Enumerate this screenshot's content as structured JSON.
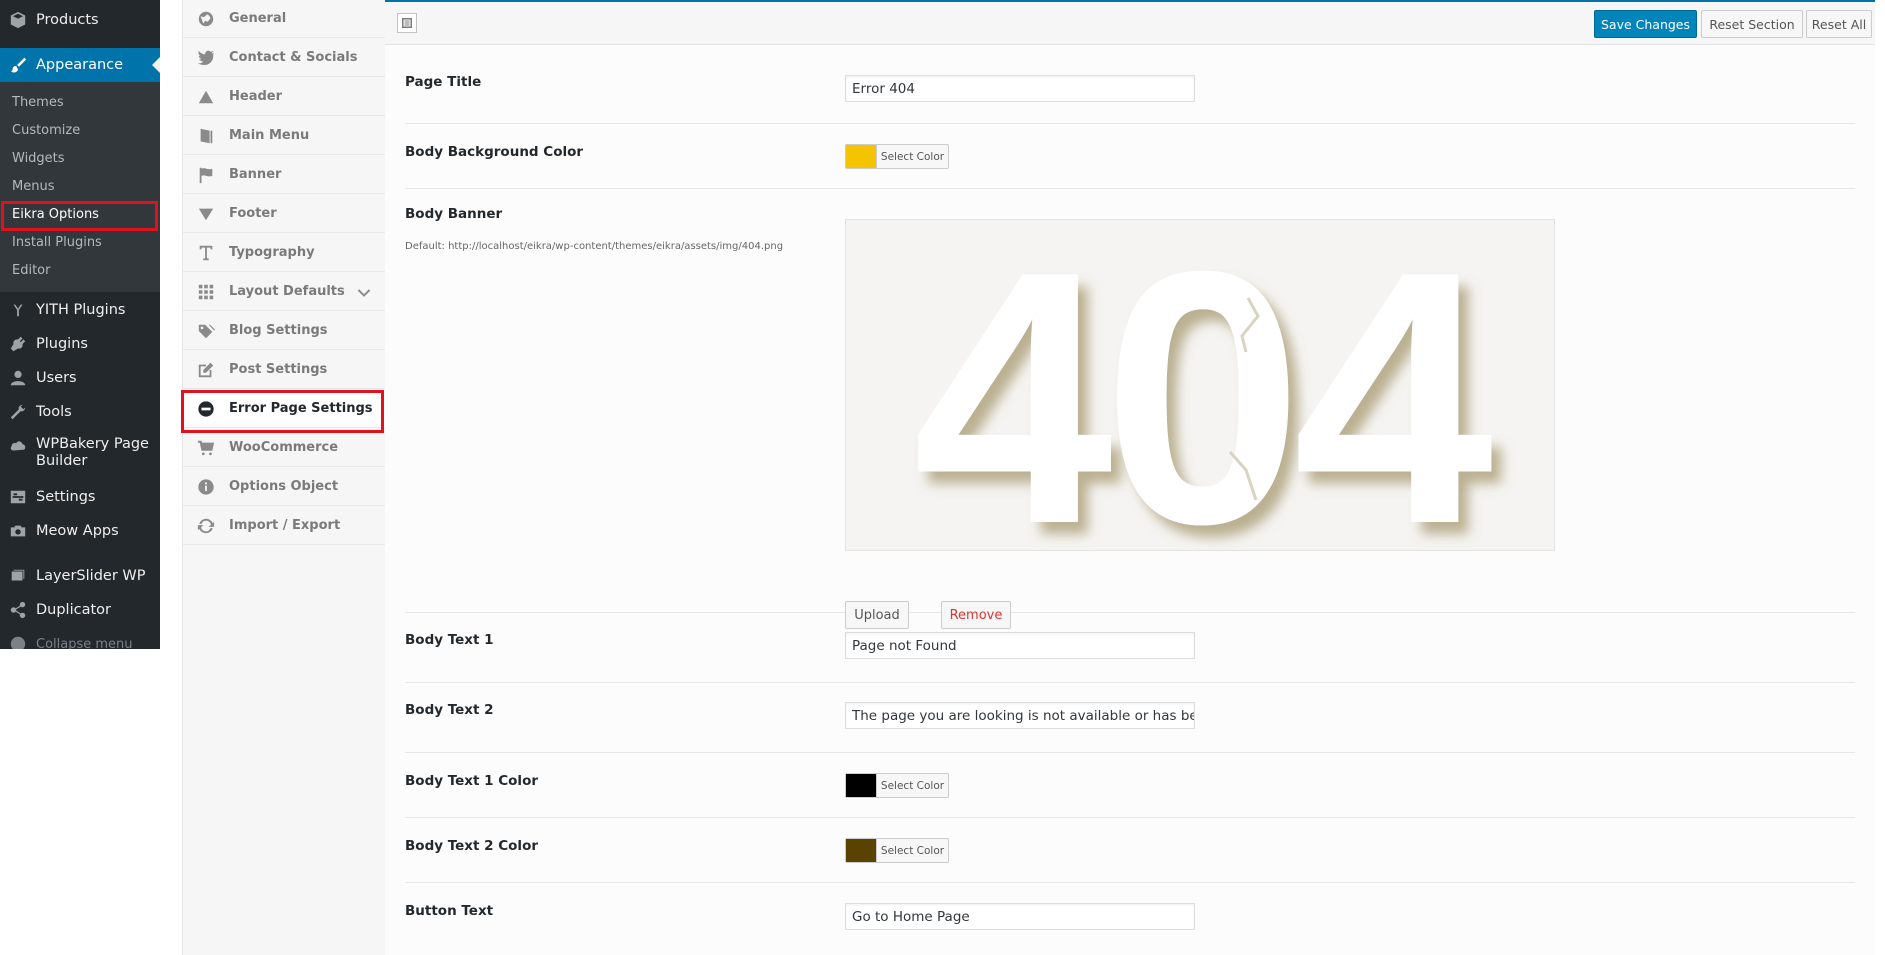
{
  "wp_menu": {
    "products": "Products",
    "appearance": "Appearance",
    "submenu": [
      "Themes",
      "Customize",
      "Widgets",
      "Menus",
      "Eikra Options",
      "Install Plugins",
      "Editor"
    ],
    "yith": "YITH Plugins",
    "plugins": "Plugins",
    "users": "Users",
    "tools": "Tools",
    "wpbakery": "WPBakery Page Builder",
    "settings": "Settings",
    "meow": "Meow Apps",
    "layerslider": "LayerSlider WP",
    "duplicator": "Duplicator",
    "collapse": "Collapse menu"
  },
  "options_menu": [
    {
      "label": "General",
      "icon": "globe-icon"
    },
    {
      "label": "Contact & Socials",
      "icon": "twitter-icon"
    },
    {
      "label": "Header",
      "icon": "triangle-up-icon"
    },
    {
      "label": "Main Menu",
      "icon": "book-icon"
    },
    {
      "label": "Banner",
      "icon": "flag-icon"
    },
    {
      "label": "Footer",
      "icon": "triangle-down-icon"
    },
    {
      "label": "Typography",
      "icon": "text-icon"
    },
    {
      "label": "Layout Defaults",
      "icon": "grid-icon"
    },
    {
      "label": "Blog Settings",
      "icon": "tags-icon"
    },
    {
      "label": "Post Settings",
      "icon": "edit-icon"
    },
    {
      "label": "Error Page Settings",
      "icon": "minus-circle-icon"
    },
    {
      "label": "WooCommerce",
      "icon": "cart-icon"
    },
    {
      "label": "Options Object",
      "icon": "info-icon"
    },
    {
      "label": "Import / Export",
      "icon": "refresh-icon"
    }
  ],
  "toolbar": {
    "save": "Save Changes",
    "reset_section": "Reset Section",
    "reset_all": "Reset All"
  },
  "fields": {
    "page_title": {
      "label": "Page Title",
      "value": "Error 404"
    },
    "body_bg_color": {
      "label": "Body Background Color",
      "color": "#f5c400",
      "button": "Select Color"
    },
    "body_banner": {
      "label": "Body Banner",
      "desc": "Default: http://localhost/eikra/wp-content/themes/eikra/assets/img/404.png",
      "image_text": "404",
      "upload": "Upload",
      "remove": "Remove"
    },
    "body_text_1": {
      "label": "Body Text 1",
      "value": "Page not Found"
    },
    "body_text_2": {
      "label": "Body Text 2",
      "value": "The page you are looking is not available or has been r"
    },
    "body_text_1_color": {
      "label": "Body Text 1 Color",
      "color": "#000000",
      "button": "Select Color"
    },
    "body_text_2_color": {
      "label": "Body Text 2 Color",
      "color": "#5a4200",
      "button": "Select Color"
    },
    "button_text": {
      "label": "Button Text",
      "value": "Go to Home Page"
    }
  }
}
